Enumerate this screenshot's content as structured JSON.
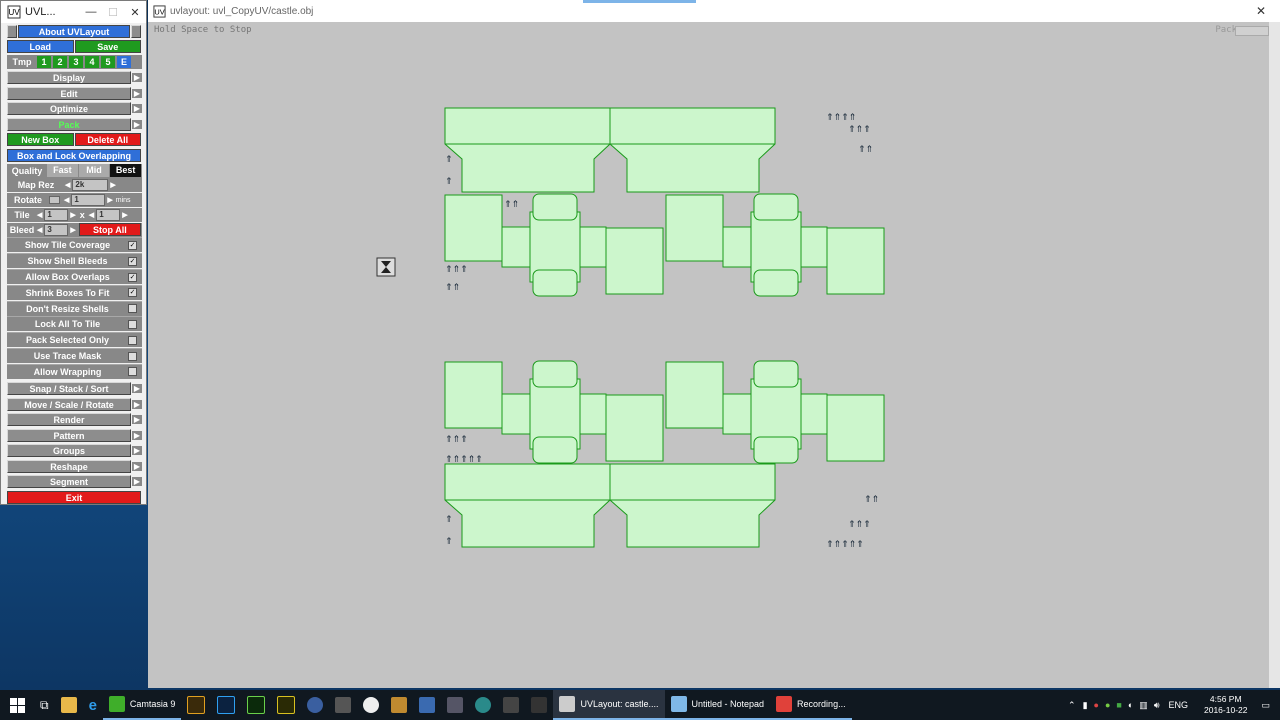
{
  "tool_window": {
    "title": "UVL...",
    "about_label": "About UVLayout",
    "load_label": "Load",
    "save_label": "Save",
    "tmp_label": "Tmp",
    "tmp_slots": [
      "1",
      "2",
      "3",
      "4",
      "5",
      "E"
    ],
    "menus_top": [
      {
        "label": "Display",
        "color": "#ffffff"
      },
      {
        "label": "Edit",
        "color": "#ffffff"
      },
      {
        "label": "Optimize",
        "color": "#ffffff"
      },
      {
        "label": "Pack",
        "color": "#55ff55"
      }
    ],
    "new_box_label": "New Box",
    "delete_all_label": "Delete All",
    "box_lock_label": "Box and Lock Overlapping",
    "quality_label": "Quality",
    "quality_options": [
      "Fast",
      "Mid",
      "Best"
    ],
    "quality_selected": "Best",
    "map_rez_label": "Map Rez",
    "map_rez_value": "2k",
    "rotate_label": "Rotate",
    "rotate_value": "1",
    "rotate_unit": "mins",
    "tile_label": "Tile",
    "tile_x": "1",
    "tile_sep": "x",
    "tile_y": "1",
    "bleed_label": "Bleed",
    "bleed_value": "3",
    "stop_all_label": "Stop All",
    "options": [
      {
        "label": "Show Tile Coverage",
        "checked": true
      },
      {
        "label": "Show Shell Bleeds",
        "checked": true
      },
      {
        "label": "Allow Box Overlaps",
        "checked": true
      },
      {
        "label": "Shrink Boxes To Fit",
        "checked": true
      },
      {
        "label": "Don't Resize Shells",
        "checked": false
      },
      {
        "label": "Lock All To Tile",
        "checked": false
      },
      {
        "label": "Pack Selected Only",
        "checked": false
      },
      {
        "label": "Use Trace Mask",
        "checked": false
      },
      {
        "label": "Allow Wrapping",
        "checked": false
      }
    ],
    "menus_bottom": [
      "Snap / Stack / Sort",
      "Move / Scale / Rotate",
      "Render",
      "Pattern",
      "Groups",
      "Reshape",
      "Segment"
    ],
    "exit_label": "Exit"
  },
  "uv_window": {
    "title": "uvlayout: uvl_CopyUV/castle.obj",
    "hint": "Hold Space to Stop",
    "pack_label": "Pack",
    "close_glyph": "✕"
  },
  "taskbar": {
    "apps": [
      {
        "label": "Camtasia 9",
        "color": "#3fae2a",
        "state": "open"
      },
      {
        "label": "UVLayout: castle....",
        "color": "#cccccc",
        "state": "active"
      },
      {
        "label": "Untitled - Notepad",
        "color": "#7fb8e8",
        "state": "open"
      },
      {
        "label": "Recording...",
        "color": "#e0413a",
        "state": "open"
      }
    ],
    "lang": "ENG",
    "time": "4:56 PM",
    "date": "2016-10-22"
  }
}
